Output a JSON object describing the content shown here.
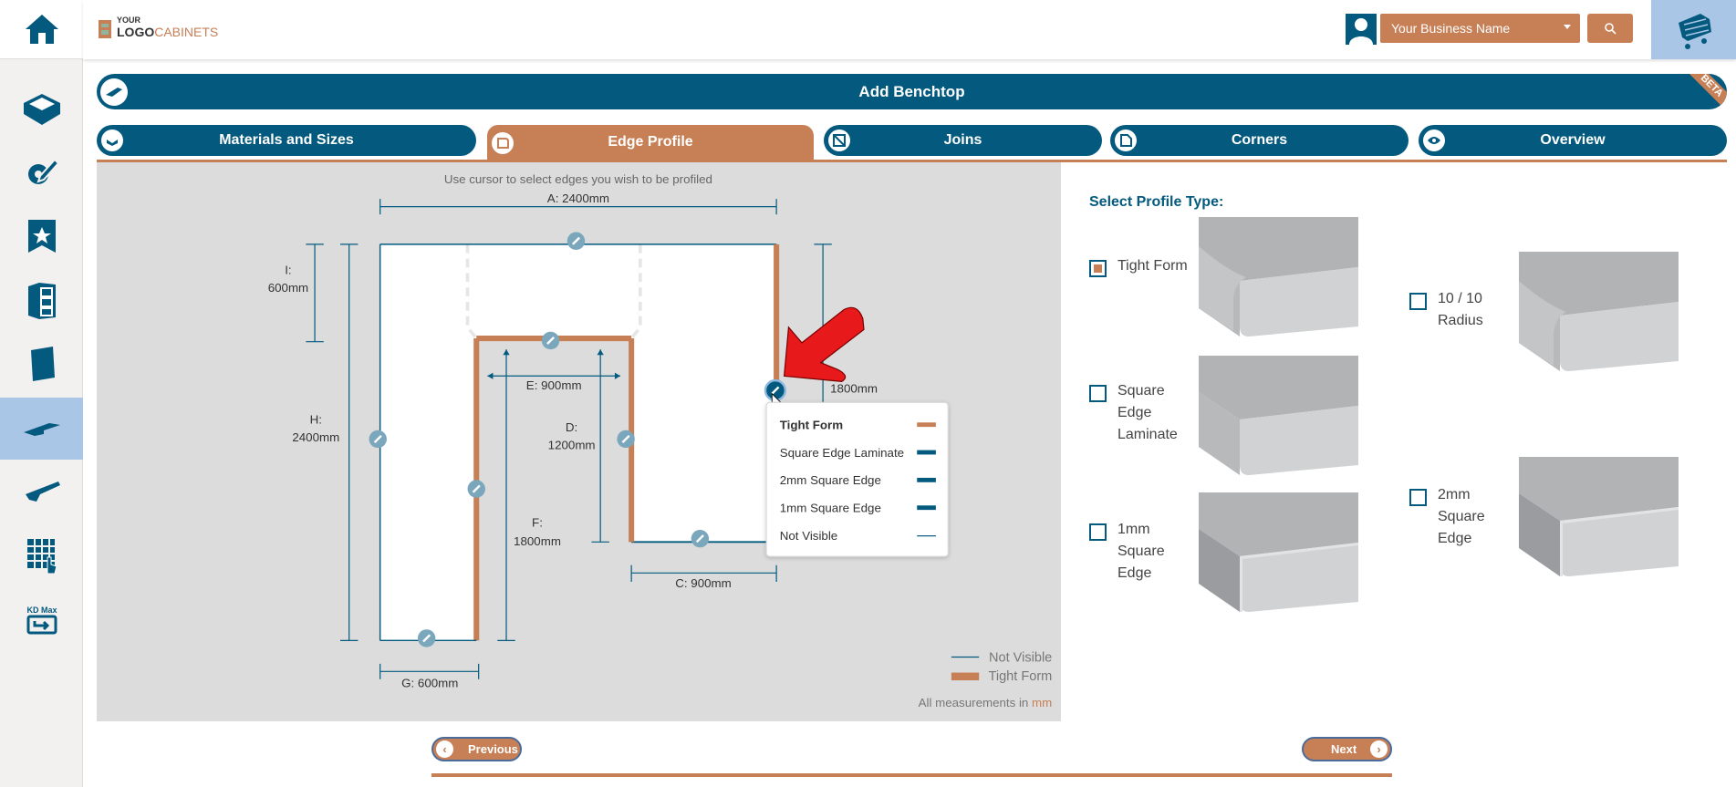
{
  "colors": {
    "brand_blue": "#035a7e",
    "accent_orange": "#c77f56",
    "active_nav": "#a9c6e6",
    "canvas_bg": "#dcdcdc"
  },
  "header": {
    "logo": {
      "line1": "YOUR",
      "line2": "LOGO",
      "line3": "CABINETS"
    },
    "business_select": "Your Business Name",
    "search_icon": "search-icon",
    "cart_icon": "cart-icon"
  },
  "sidebar": {
    "items": [
      {
        "icon": "home-icon"
      },
      {
        "icon": "room-icon"
      },
      {
        "icon": "settings-pencil-icon"
      },
      {
        "icon": "bookmark-star-icon"
      },
      {
        "icon": "cabinet-drawers-icon"
      },
      {
        "icon": "panel-icon"
      },
      {
        "icon": "benchtop-icon",
        "active": true
      },
      {
        "icon": "hinge-icon"
      },
      {
        "icon": "grid-select-icon"
      },
      {
        "icon": "kd-max-import-icon",
        "label": "KD Max"
      }
    ]
  },
  "title_bar": {
    "title": "Add Benchtop",
    "badge": "BETA"
  },
  "tabs": [
    {
      "label": "Materials and Sizes"
    },
    {
      "label": "Edge Profile",
      "active": true
    },
    {
      "label": "Joins"
    },
    {
      "label": "Corners"
    },
    {
      "label": "Overview"
    }
  ],
  "canvas": {
    "instruction": "Use cursor to select edges you wish to be profiled",
    "dimensions": {
      "A": "A: 2400mm",
      "I_label": "I:",
      "I_value": "600mm",
      "H_label": "H:",
      "H_value": "2400mm",
      "E": "E: 900mm",
      "D_label": "D:",
      "D_value": "1200mm",
      "F_label": "F:",
      "F_value": "1800mm",
      "C": "C: 900mm",
      "G": "G: 600mm",
      "B_value": "1800mm"
    },
    "popup": {
      "items": [
        {
          "label": "Tight Form",
          "selected": true,
          "color": "#c77f56"
        },
        {
          "label": "Square Edge Laminate",
          "color": "#035a7e"
        },
        {
          "label": "2mm Square Edge",
          "color": "#035a7e"
        },
        {
          "label": "1mm Square Edge",
          "color": "#035a7e"
        },
        {
          "label": "Not Visible",
          "color": "#035a7e"
        }
      ]
    },
    "legend": {
      "not_visible": "Not Visible",
      "tight_form": "Tight Form",
      "units_prefix": "All measurements in",
      "units": "mm"
    }
  },
  "profiles": {
    "title": "Select Profile Type:",
    "options": [
      {
        "label": "Tight Form",
        "checked": true
      },
      {
        "label": "10 / 10 Radius",
        "checked": false
      },
      {
        "label": "Square Edge Laminate",
        "checked": false
      },
      {
        "label": "1mm Square Edge",
        "checked": false
      },
      {
        "label": "2mm Square Edge",
        "checked": false
      }
    ]
  },
  "footer": {
    "previous": "Previous",
    "next": "Next"
  }
}
